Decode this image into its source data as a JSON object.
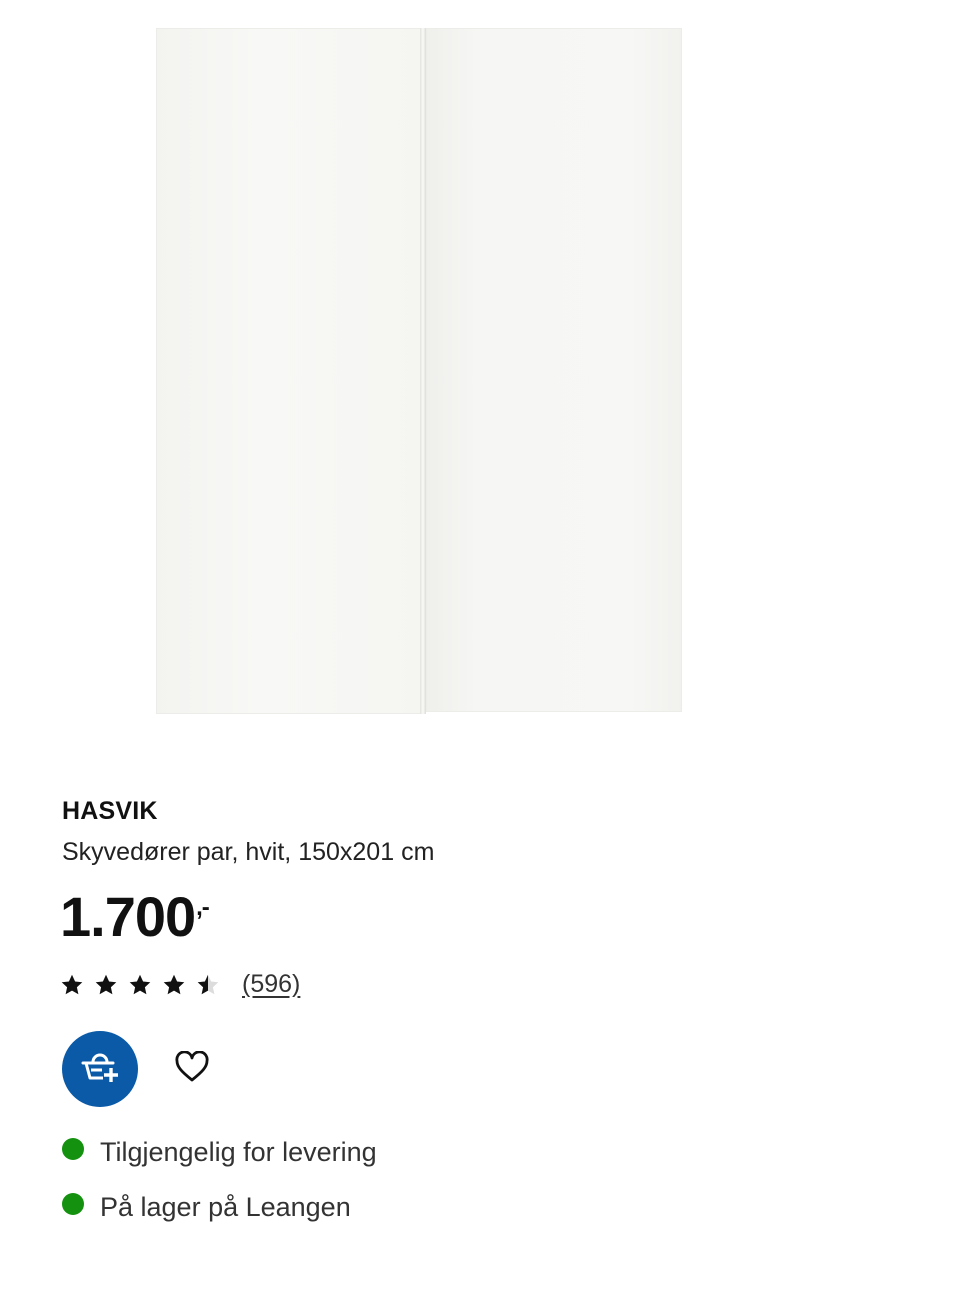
{
  "product": {
    "image_icon": "sliding-doors-image",
    "name": "HASVIK",
    "description": "Skyvedører par, hvit, 150x201 cm",
    "price": "1.700",
    "price_suffix": ",-"
  },
  "rating": {
    "stars": 4.5,
    "max_stars": 5,
    "review_count": "(596)"
  },
  "actions": {
    "add_to_cart_icon": "add-to-basket-icon",
    "favorite_icon": "heart-icon",
    "accent_color": "#0a5aa8"
  },
  "availability": {
    "status_color": "#14920f",
    "items": [
      {
        "label": "Tilgjengelig for levering"
      },
      {
        "label": "På lager på Leangen"
      }
    ]
  }
}
